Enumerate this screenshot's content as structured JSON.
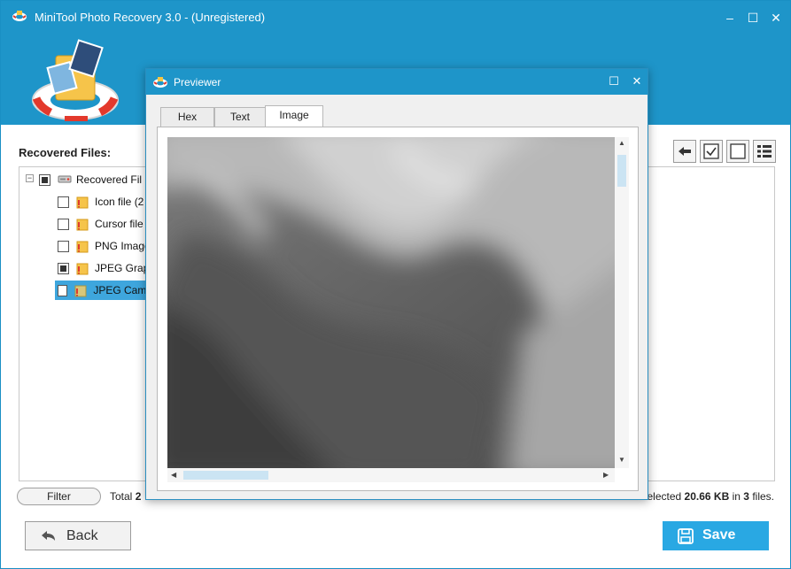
{
  "window": {
    "title": "MiniTool Photo Recovery 3.0 - (Unregistered)",
    "minimize": "–",
    "maximize": "☐",
    "close": "✕"
  },
  "panel": {
    "recovered_label": "Recovered Files:"
  },
  "tree": {
    "root": {
      "label": "Recovered Fil",
      "checked": "partial"
    },
    "items": [
      {
        "label": "Icon file (2",
        "checked": false,
        "selected": false
      },
      {
        "label": "Cursor file",
        "checked": false,
        "selected": false
      },
      {
        "label": "PNG Image",
        "checked": false,
        "selected": false
      },
      {
        "label": "JPEG Grap",
        "checked": "partial",
        "selected": false
      },
      {
        "label": "JPEG Came",
        "checked": false,
        "selected": true
      }
    ]
  },
  "status": {
    "filter_label": "Filter",
    "total_prefix": "Total",
    "total_value": "2",
    "selected_prefix": "elected",
    "selected_size": "20.66 KB",
    "selected_mid": "in",
    "selected_count": "3",
    "selected_suffix": "files."
  },
  "footer": {
    "back_label": "Back",
    "save_label": "Save"
  },
  "previewer": {
    "title": "Previewer",
    "maximize": "☐",
    "close": "✕",
    "tabs": [
      "Hex",
      "Text",
      "Image"
    ],
    "active_tab": "Image"
  },
  "colors": {
    "title_bar": "#1e95c9",
    "accent": "#29a8e3",
    "selected_row": "#3ea6dd"
  },
  "icons": {
    "app": "lifebuoy-icon",
    "toolbar": [
      "back-arrow-icon",
      "check-all-icon",
      "uncheck-all-icon",
      "list-view-icon"
    ]
  }
}
